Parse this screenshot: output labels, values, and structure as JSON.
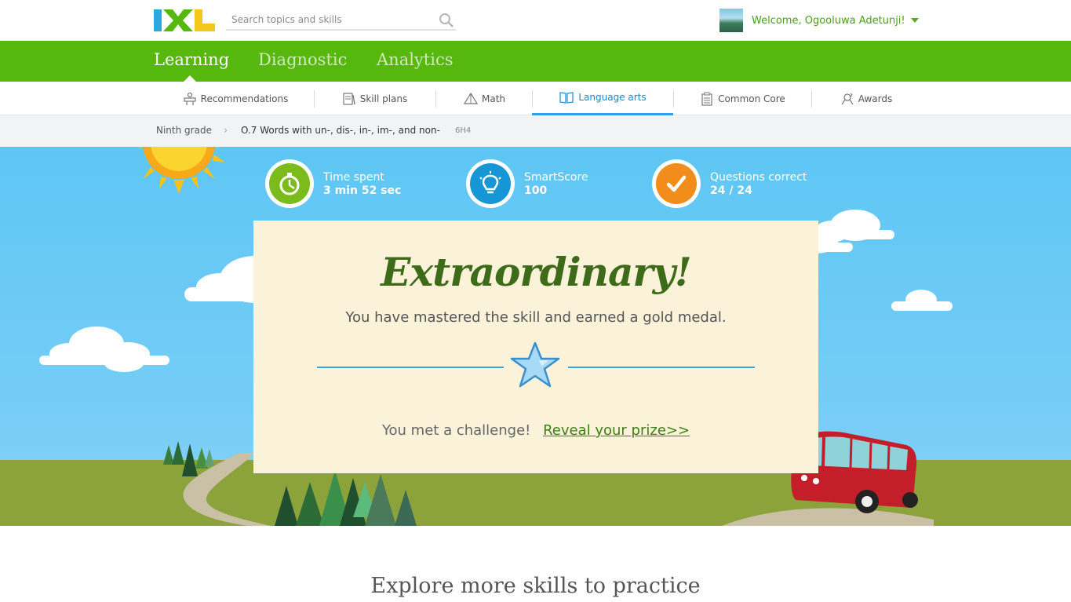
{
  "header": {
    "logo_text": "IXL",
    "search_placeholder": "Search topics and skills",
    "welcome": "Welcome, Ogooluwa Adetunji!"
  },
  "main_nav": {
    "tabs": [
      {
        "label": "Learning",
        "active": true
      },
      {
        "label": "Diagnostic",
        "active": false
      },
      {
        "label": "Analytics",
        "active": false
      }
    ]
  },
  "sub_nav": {
    "items": [
      {
        "label": "Recommendations",
        "icon": "recommendations-icon"
      },
      {
        "label": "Skill plans",
        "icon": "skill-plans-icon"
      },
      {
        "label": "Math",
        "icon": "math-pyramid-icon"
      },
      {
        "label": "Language arts",
        "icon": "book-icon",
        "active": true
      },
      {
        "label": "Common Core",
        "icon": "clipboard-icon"
      },
      {
        "label": "Awards",
        "icon": "awards-icon"
      }
    ]
  },
  "breadcrumb": {
    "grade": "Ninth grade",
    "skill": "O.7 Words with un-, dis-, in-, im-, and non-",
    "code": "6H4"
  },
  "stats": {
    "time_label": "Time spent",
    "time_value": "3 min 52 sec",
    "score_label": "SmartScore",
    "score_value": "100",
    "questions_label": "Questions correct",
    "questions_value": "24 / 24"
  },
  "result": {
    "headline": "Extraordinary!",
    "message": "You have mastered the skill and earned a gold medal.",
    "challenge_text": "You met a challenge!",
    "prize_link": "Reveal your prize>>"
  },
  "explore": {
    "title": "Explore more skills to practice"
  },
  "colors": {
    "brand_green": "#56b70c",
    "active_blue": "#2ea2e6",
    "sky": "#5ec6f4",
    "card_bg": "#faf2d9",
    "headline_green": "#3d6b19"
  }
}
